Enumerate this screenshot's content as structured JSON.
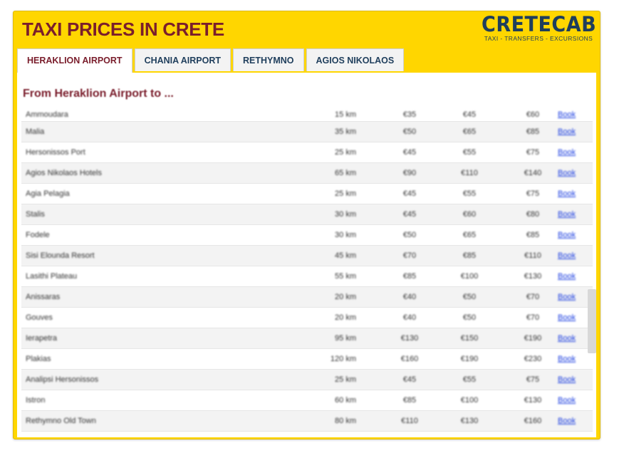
{
  "header": {
    "title": "TAXI PRICES IN CRETE",
    "logo": {
      "word": "CRETECAB",
      "tagline": "TAXI - TRANSFERS - EXCURSIONS"
    }
  },
  "tabs": [
    {
      "label": "HERAKLION AIRPORT",
      "active": true
    },
    {
      "label": "CHANIA AIRPORT",
      "active": false
    },
    {
      "label": "RETHYMNO",
      "active": false
    },
    {
      "label": "AGIOS NIKOLAOS",
      "active": false
    }
  ],
  "panel": {
    "subtitle": "From Heraklion Airport to ...",
    "rows": [
      {
        "destination": "Ammoudara",
        "distance": "15 km",
        "p1": "€35",
        "p2": "€45",
        "p3": "€60",
        "book": "Book"
      },
      {
        "destination": "Malia",
        "distance": "35 km",
        "p1": "€50",
        "p2": "€65",
        "p3": "€85",
        "book": "Book"
      },
      {
        "destination": "Hersonissos Port",
        "distance": "25 km",
        "p1": "€45",
        "p2": "€55",
        "p3": "€75",
        "book": "Book"
      },
      {
        "destination": "Agios Nikolaos Hotels",
        "distance": "65 km",
        "p1": "€90",
        "p2": "€110",
        "p3": "€140",
        "book": "Book"
      },
      {
        "destination": "Agia Pelagia",
        "distance": "25 km",
        "p1": "€45",
        "p2": "€55",
        "p3": "€75",
        "book": "Book"
      },
      {
        "destination": "Stalis",
        "distance": "30 km",
        "p1": "€45",
        "p2": "€60",
        "p3": "€80",
        "book": "Book"
      },
      {
        "destination": "Fodele",
        "distance": "30 km",
        "p1": "€50",
        "p2": "€65",
        "p3": "€85",
        "book": "Book"
      },
      {
        "destination": "Sisi Elounda Resort",
        "distance": "45 km",
        "p1": "€70",
        "p2": "€85",
        "p3": "€110",
        "book": "Book"
      },
      {
        "destination": "Lasithi Plateau",
        "distance": "55 km",
        "p1": "€85",
        "p2": "€100",
        "p3": "€130",
        "book": "Book"
      },
      {
        "destination": "Anissaras",
        "distance": "20 km",
        "p1": "€40",
        "p2": "€50",
        "p3": "€70",
        "book": "Book"
      },
      {
        "destination": "Gouves",
        "distance": "20 km",
        "p1": "€40",
        "p2": "€50",
        "p3": "€70",
        "book": "Book"
      },
      {
        "destination": "Ierapetra",
        "distance": "95 km",
        "p1": "€130",
        "p2": "€150",
        "p3": "€190",
        "book": "Book"
      },
      {
        "destination": "Plakias",
        "distance": "120 km",
        "p1": "€160",
        "p2": "€190",
        "p3": "€230",
        "book": "Book"
      },
      {
        "destination": "Analipsi Hersonissos",
        "distance": "25 km",
        "p1": "€45",
        "p2": "€55",
        "p3": "€75",
        "book": "Book"
      },
      {
        "destination": "Istron",
        "distance": "60 km",
        "p1": "€85",
        "p2": "€100",
        "p3": "€130",
        "book": "Book"
      },
      {
        "destination": "Rethymno Old Town",
        "distance": "80 km",
        "p1": "€110",
        "p2": "€130",
        "p3": "€160",
        "book": "Book"
      }
    ]
  },
  "colors": {
    "frame": "#ffd600",
    "title": "#7a1e2c",
    "logo": "#1f3e5c",
    "link": "#1a3de0"
  }
}
